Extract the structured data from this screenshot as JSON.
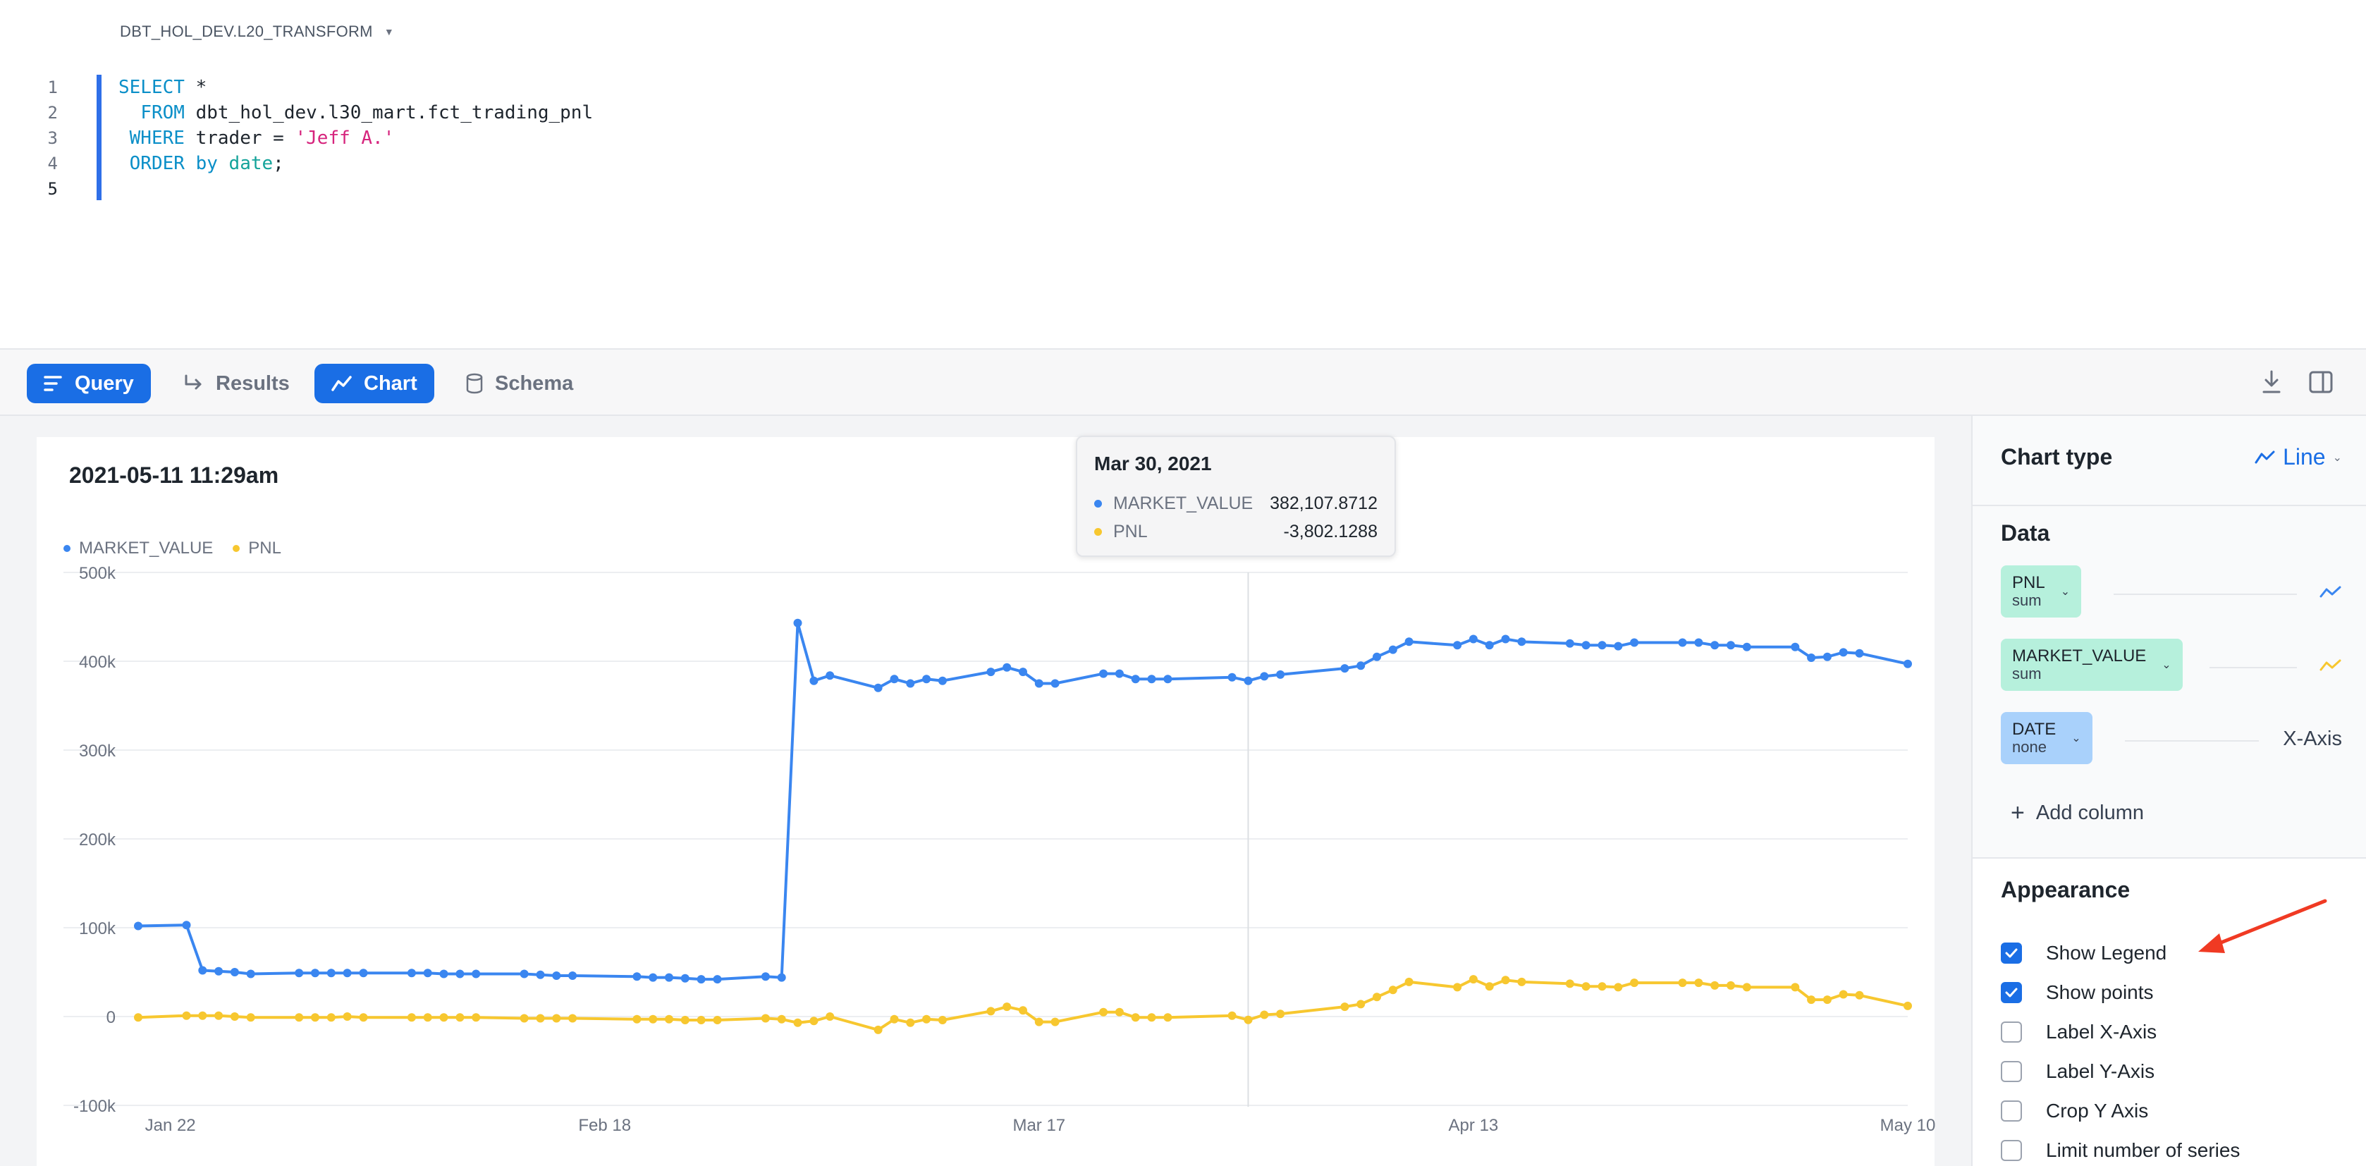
{
  "editor": {
    "context": "DBT_HOL_DEV.L20_TRANSFORM",
    "line_numbers": [
      "1",
      "2",
      "3",
      "4",
      "5"
    ],
    "code": {
      "l1_kw": "SELECT",
      "l1_tx": " *",
      "l2_kw": "FROM",
      "l2_tx": " dbt_hol_dev.l30_mart.fct_trading_pnl",
      "l3_kw": "WHERE",
      "l3_tx": " trader = ",
      "l3_str": "'Jeff A.'",
      "l4_kw": "ORDER by",
      "l4_tx": " ",
      "l4_col": "date",
      "l4_end": ";"
    }
  },
  "toolbar": {
    "tabs": [
      {
        "label": "Query",
        "active": true,
        "icon": "query-lines-icon"
      },
      {
        "label": "Results",
        "active": false,
        "icon": "results-arrow-icon"
      },
      {
        "label": "Chart",
        "active": true,
        "icon": "chart-line-icon"
      },
      {
        "label": "Schema",
        "active": false,
        "icon": "database-icon"
      }
    ],
    "right_icons": [
      "download-icon",
      "split-panel-icon"
    ]
  },
  "chart": {
    "title": "2021-05-11 11:29am",
    "tooltip": {
      "date": "Mar 30, 2021",
      "rows": [
        {
          "name": "MARKET_VALUE",
          "value": "382,107.8712",
          "color": "#3a86f0"
        },
        {
          "name": "PNL",
          "value": "-3,802.1288",
          "color": "#f7c72f"
        }
      ]
    }
  },
  "chart_data": {
    "type": "line",
    "title": "2021-05-11 11:29am",
    "xlabel": "",
    "ylabel": "",
    "x_ticks": [
      "Jan 22",
      "Feb 18",
      "Mar 17",
      "Apr 13",
      "May 10"
    ],
    "y_ticks": [
      "500k",
      "400k",
      "300k",
      "200k",
      "100k",
      "0",
      "-100k"
    ],
    "ylim": [
      -100000,
      500000
    ],
    "xlim": [
      "2021-01-20",
      "2021-05-10"
    ],
    "grid": true,
    "legend": "top-left",
    "series": [
      {
        "name": "MARKET_VALUE",
        "color": "#3a86f0",
        "points": [
          [
            "2021-01-20",
            102000
          ],
          [
            "2021-01-23",
            103000
          ],
          [
            "2021-01-24",
            52000
          ],
          [
            "2021-01-25",
            51000
          ],
          [
            "2021-01-26",
            50000
          ],
          [
            "2021-01-27",
            48000
          ],
          [
            "2021-01-30",
            49000
          ],
          [
            "2021-01-31",
            49000
          ],
          [
            "2021-02-01",
            49000
          ],
          [
            "2021-02-02",
            49000
          ],
          [
            "2021-02-03",
            49000
          ],
          [
            "2021-02-06",
            49000
          ],
          [
            "2021-02-07",
            49000
          ],
          [
            "2021-02-08",
            48000
          ],
          [
            "2021-02-09",
            48000
          ],
          [
            "2021-02-10",
            48000
          ],
          [
            "2021-02-13",
            48000
          ],
          [
            "2021-02-14",
            47000
          ],
          [
            "2021-02-15",
            46000
          ],
          [
            "2021-02-16",
            46000
          ],
          [
            "2021-02-20",
            45000
          ],
          [
            "2021-02-21",
            44000
          ],
          [
            "2021-02-22",
            44000
          ],
          [
            "2021-02-23",
            43000
          ],
          [
            "2021-02-24",
            42000
          ],
          [
            "2021-02-25",
            42000
          ],
          [
            "2021-02-28",
            45000
          ],
          [
            "2021-03-01",
            44000
          ],
          [
            "2021-03-02",
            443000
          ],
          [
            "2021-03-03",
            378000
          ],
          [
            "2021-03-04",
            384000
          ],
          [
            "2021-03-07",
            370000
          ],
          [
            "2021-03-08",
            380000
          ],
          [
            "2021-03-09",
            375000
          ],
          [
            "2021-03-10",
            380000
          ],
          [
            "2021-03-11",
            378000
          ],
          [
            "2021-03-14",
            388000
          ],
          [
            "2021-03-15",
            393000
          ],
          [
            "2021-03-16",
            388000
          ],
          [
            "2021-03-17",
            375000
          ],
          [
            "2021-03-18",
            375000
          ],
          [
            "2021-03-21",
            386000
          ],
          [
            "2021-03-22",
            386000
          ],
          [
            "2021-03-23",
            380000
          ],
          [
            "2021-03-24",
            380000
          ],
          [
            "2021-03-25",
            380000
          ],
          [
            "2021-03-29",
            382000
          ],
          [
            "2021-03-30",
            378000
          ],
          [
            "2021-03-31",
            383000
          ],
          [
            "2021-04-01",
            385000
          ],
          [
            "2021-04-05",
            392000
          ],
          [
            "2021-04-06",
            395000
          ],
          [
            "2021-04-07",
            405000
          ],
          [
            "2021-04-08",
            413000
          ],
          [
            "2021-04-09",
            422000
          ],
          [
            "2021-04-12",
            418000
          ],
          [
            "2021-04-13",
            425000
          ],
          [
            "2021-04-14",
            418000
          ],
          [
            "2021-04-15",
            425000
          ],
          [
            "2021-04-16",
            422000
          ],
          [
            "2021-04-19",
            420000
          ],
          [
            "2021-04-20",
            418000
          ],
          [
            "2021-04-21",
            418000
          ],
          [
            "2021-04-22",
            417000
          ],
          [
            "2021-04-23",
            421000
          ],
          [
            "2021-04-26",
            421000
          ],
          [
            "2021-04-27",
            421000
          ],
          [
            "2021-04-28",
            418000
          ],
          [
            "2021-04-29",
            418000
          ],
          [
            "2021-04-30",
            416000
          ],
          [
            "2021-05-03",
            416000
          ],
          [
            "2021-05-04",
            404000
          ],
          [
            "2021-05-05",
            405000
          ],
          [
            "2021-05-06",
            410000
          ],
          [
            "2021-05-07",
            409000
          ],
          [
            "2021-05-10",
            397000
          ]
        ]
      },
      {
        "name": "PNL",
        "color": "#f7c72f",
        "points": [
          [
            "2021-01-20",
            -1000
          ],
          [
            "2021-01-23",
            1000
          ],
          [
            "2021-01-24",
            1000
          ],
          [
            "2021-01-25",
            1000
          ],
          [
            "2021-01-26",
            0
          ],
          [
            "2021-01-27",
            -1000
          ],
          [
            "2021-01-30",
            -1000
          ],
          [
            "2021-01-31",
            -1000
          ],
          [
            "2021-02-01",
            -1000
          ],
          [
            "2021-02-02",
            0
          ],
          [
            "2021-02-03",
            -1000
          ],
          [
            "2021-02-06",
            -1000
          ],
          [
            "2021-02-07",
            -1000
          ],
          [
            "2021-02-08",
            -1000
          ],
          [
            "2021-02-09",
            -1000
          ],
          [
            "2021-02-10",
            -1000
          ],
          [
            "2021-02-13",
            -2000
          ],
          [
            "2021-02-14",
            -2000
          ],
          [
            "2021-02-15",
            -2000
          ],
          [
            "2021-02-16",
            -2000
          ],
          [
            "2021-02-20",
            -3000
          ],
          [
            "2021-02-21",
            -3000
          ],
          [
            "2021-02-22",
            -3000
          ],
          [
            "2021-02-23",
            -4000
          ],
          [
            "2021-02-24",
            -4000
          ],
          [
            "2021-02-25",
            -4000
          ],
          [
            "2021-02-28",
            -2000
          ],
          [
            "2021-03-01",
            -3000
          ],
          [
            "2021-03-02",
            -7000
          ],
          [
            "2021-03-03",
            -5000
          ],
          [
            "2021-03-04",
            0
          ],
          [
            "2021-03-07",
            -15000
          ],
          [
            "2021-03-08",
            -3000
          ],
          [
            "2021-03-09",
            -7000
          ],
          [
            "2021-03-10",
            -3000
          ],
          [
            "2021-03-11",
            -4000
          ],
          [
            "2021-03-14",
            6000
          ],
          [
            "2021-03-15",
            11000
          ],
          [
            "2021-03-16",
            7000
          ],
          [
            "2021-03-17",
            -6000
          ],
          [
            "2021-03-18",
            -6000
          ],
          [
            "2021-03-21",
            5000
          ],
          [
            "2021-03-22",
            5000
          ],
          [
            "2021-03-23",
            -1000
          ],
          [
            "2021-03-24",
            -1000
          ],
          [
            "2021-03-25",
            -1000
          ],
          [
            "2021-03-29",
            1000
          ],
          [
            "2021-03-30",
            -3800
          ],
          [
            "2021-03-31",
            2000
          ],
          [
            "2021-04-01",
            3000
          ],
          [
            "2021-04-05",
            11000
          ],
          [
            "2021-04-06",
            14000
          ],
          [
            "2021-04-07",
            22000
          ],
          [
            "2021-04-08",
            30000
          ],
          [
            "2021-04-09",
            39000
          ],
          [
            "2021-04-12",
            33000
          ],
          [
            "2021-04-13",
            42000
          ],
          [
            "2021-04-14",
            34000
          ],
          [
            "2021-04-15",
            41000
          ],
          [
            "2021-04-16",
            39000
          ],
          [
            "2021-04-19",
            37000
          ],
          [
            "2021-04-20",
            34000
          ],
          [
            "2021-04-21",
            34000
          ],
          [
            "2021-04-22",
            33000
          ],
          [
            "2021-04-23",
            38000
          ],
          [
            "2021-04-26",
            38000
          ],
          [
            "2021-04-27",
            38000
          ],
          [
            "2021-04-28",
            35000
          ],
          [
            "2021-04-29",
            35000
          ],
          [
            "2021-04-30",
            33000
          ],
          [
            "2021-05-03",
            33000
          ],
          [
            "2021-05-04",
            19000
          ],
          [
            "2021-05-05",
            19000
          ],
          [
            "2021-05-06",
            25000
          ],
          [
            "2021-05-07",
            24000
          ],
          [
            "2021-05-10",
            12000
          ]
        ]
      }
    ],
    "hover": {
      "date": "2021-03-30"
    }
  },
  "panel": {
    "chart_type_label": "Chart type",
    "chart_type_value": "Line",
    "data_label": "Data",
    "columns": [
      {
        "name": "PNL",
        "agg": "sum",
        "role": "",
        "role_icon": "line-series-icon",
        "role_color": "#3a86f0",
        "pill": "green"
      },
      {
        "name": "MARKET_VALUE",
        "agg": "sum",
        "role": "",
        "role_icon": "line-series-icon",
        "role_color": "#f7c72f",
        "pill": "green"
      },
      {
        "name": "DATE",
        "agg": "none",
        "role": "X-Axis",
        "pill": "blue"
      }
    ],
    "add_column": "Add column",
    "appearance_label": "Appearance",
    "options": [
      {
        "label": "Show Legend",
        "checked": true
      },
      {
        "label": "Show points",
        "checked": true
      },
      {
        "label": "Label X-Axis",
        "checked": false
      },
      {
        "label": "Label Y-Axis",
        "checked": false
      },
      {
        "label": "Crop Y Axis",
        "checked": false
      },
      {
        "label": "Limit number of series",
        "checked": false
      }
    ]
  },
  "colors": {
    "accent": "#1a6ee5",
    "annotation_arrow": "#f03a23"
  }
}
